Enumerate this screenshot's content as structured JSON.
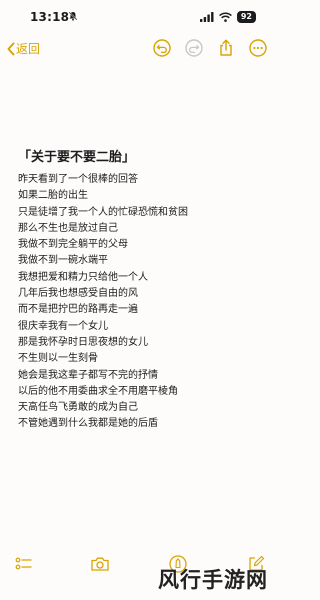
{
  "status_bar": {
    "time": "13:18",
    "battery": "92"
  },
  "nav": {
    "back_label": "返回"
  },
  "note": {
    "title": "「关于要不要二胎」",
    "lines": [
      "昨天看到了一个很棒的回答",
      "如果二胎的出生",
      "只是徒增了我一个人的忙碌恐慌和贫困",
      "那么不生也是放过自己",
      "我做不到完全躺平的父母",
      "我做不到一碗水端平",
      "我想把爱和精力只给他一个人",
      "几年后我也想感受自由的风",
      "而不是把拧巴的路再走一遍",
      "很庆幸我有一个女儿",
      "那是我怀孕时日思夜想的女儿",
      "不生则以一生刻骨",
      "她会是我这辈子都写不完的抒情",
      "以后的他不用委曲求全不用磨平棱角",
      "天高任鸟飞勇敢的成为自己",
      "不管她遇到什么我都是她的后盾"
    ]
  },
  "watermark": "风行手游网",
  "colors": {
    "accent": "#d9a400",
    "text": "#1c1c1e",
    "background": "#fdfcfa",
    "disabled": "#c7c7cc"
  },
  "icons": {
    "nav": [
      "undo-icon",
      "redo-icon",
      "share-icon",
      "more-icon"
    ],
    "toolbar": [
      "checklist-icon",
      "camera-icon",
      "markup-icon",
      "compose-icon"
    ]
  }
}
